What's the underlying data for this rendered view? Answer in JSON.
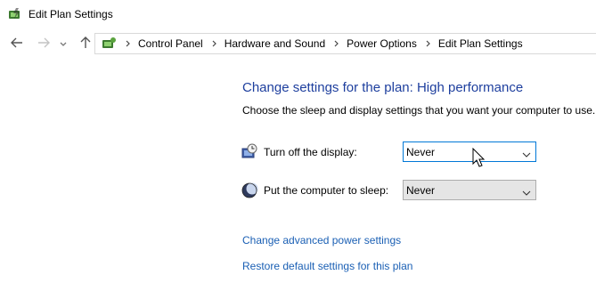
{
  "window": {
    "title": "Edit Plan Settings",
    "app_icon": "power-options-icon"
  },
  "nav": {
    "back_icon": "arrow-left-icon",
    "forward_icon": "arrow-right-icon",
    "recent_icon": "chevron-down-icon",
    "up_icon": "arrow-up-icon"
  },
  "breadcrumb": {
    "items": [
      "Control Panel",
      "Hardware and Sound",
      "Power Options",
      "Edit Plan Settings"
    ]
  },
  "content": {
    "title": "Change settings for the plan: High performance",
    "description": "Choose the sleep and display settings that you want your computer to use."
  },
  "settings": [
    {
      "icon": "display-clock-icon",
      "label": "Turn off the display:",
      "value": "Never"
    },
    {
      "icon": "moon-sleep-icon",
      "label": "Put the computer to sleep:",
      "value": "Never"
    }
  ],
  "links": {
    "advanced": "Change advanced power settings",
    "restore": "Restore default settings for this plan"
  },
  "colors": {
    "title_blue": "#1e3f9e",
    "link_blue": "#1a5fb4",
    "focus_border": "#0078d7"
  }
}
